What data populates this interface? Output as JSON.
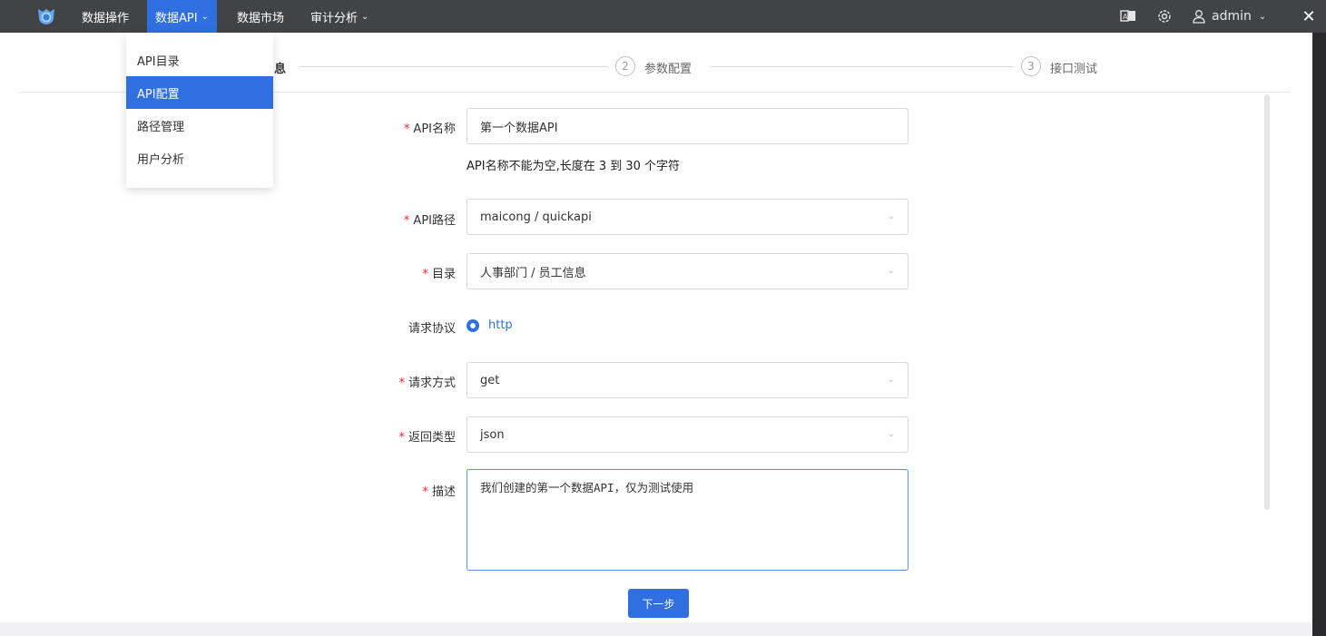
{
  "topbar": {
    "nav": [
      {
        "label": "数据操作",
        "has_dropdown": false
      },
      {
        "label": "数据API",
        "has_dropdown": true,
        "active": true
      },
      {
        "label": "数据市场",
        "has_dropdown": false
      },
      {
        "label": "审计分析",
        "has_dropdown": true
      }
    ],
    "user": {
      "name": "admin"
    },
    "icons": [
      "logo-icon",
      "translate-icon",
      "settings-icon",
      "user-icon",
      "close-icon"
    ]
  },
  "dropdown": {
    "items": [
      {
        "label": "API目录",
        "active": false
      },
      {
        "label": "API配置",
        "active": true
      },
      {
        "label": "路径管理",
        "active": false
      },
      {
        "label": "用户分析",
        "active": false
      }
    ]
  },
  "steps": {
    "step1": {
      "title_visible": "息"
    },
    "step2": {
      "number": "2",
      "label": "参数配置"
    },
    "step3": {
      "number": "3",
      "label": "接口测试"
    }
  },
  "form": {
    "name": {
      "label": "API名称",
      "value": "第一个数据API",
      "hint": "API名称不能为空,长度在 3 到 30 个字符"
    },
    "path": {
      "label": "API路径",
      "value": "maicong / quickapi"
    },
    "catalog": {
      "label": "目录",
      "value": "人事部门 / 员工信息"
    },
    "protocol": {
      "label": "请求协议",
      "value": "http"
    },
    "method": {
      "label": "请求方式",
      "value": "get"
    },
    "return_type": {
      "label": "返回类型",
      "value": "json"
    },
    "description": {
      "label": "描述",
      "value": "我们创建的第一个数据API，仅为测试使用"
    }
  },
  "actions": {
    "next_label": "下一步"
  },
  "colors": {
    "primary": "#2f6fe0",
    "topbar": "#424345",
    "required": "#f5222d"
  }
}
